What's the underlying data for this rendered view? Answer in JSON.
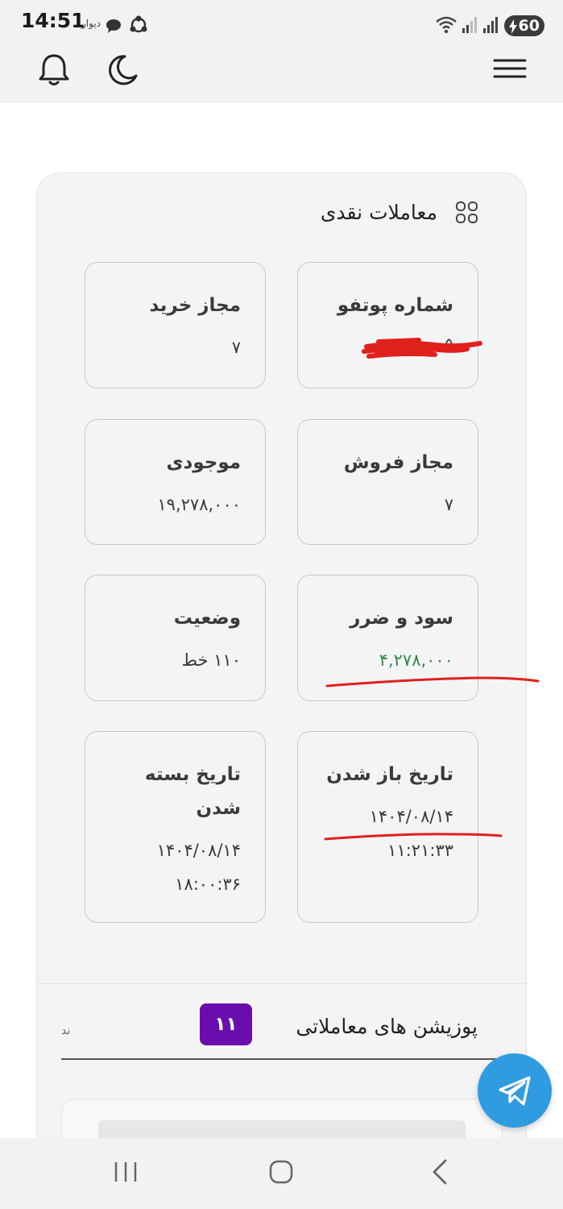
{
  "status_bar": {
    "time": "14:51",
    "app_label": "دیوار",
    "battery": "60"
  },
  "header": {
    "icons": [
      "bell-icon",
      "moon-icon",
      "hamburger-menu-icon"
    ]
  },
  "cash_trades": {
    "title": "معاملات نقدی",
    "tiles": [
      {
        "label": "شماره پوتفو",
        "value": "۵"
      },
      {
        "label": "مجاز خرید",
        "value": "۷"
      },
      {
        "label": "مجاز فروش",
        "value": "۷"
      },
      {
        "label": "موجودی",
        "value": "۱۹,۲۷۸,۰۰۰"
      },
      {
        "label": "سود و ضرر",
        "value": "۴,۲۷۸,۰۰۰"
      },
      {
        "label": "وضعیت",
        "value": "۱۱۰ خط"
      },
      {
        "label": "تاریخ باز شدن",
        "value": "۱۴۰۴/۰۸/۱۴ ۱۱:۲۱:۳۳"
      },
      {
        "label": "تاریخ بسته شدن",
        "value": "۱۴۰۴/۰۸/۱۴ ۱۸:۰۰:۳۶"
      }
    ]
  },
  "positions": {
    "title": "پوزیشن های معاملاتی",
    "count": "۱۱",
    "field_hint": "ند"
  },
  "colors": {
    "profit": "#2e8b45",
    "badge": "#6a0dad",
    "fab": "#2f9be0",
    "annotation": "#e0201c"
  }
}
